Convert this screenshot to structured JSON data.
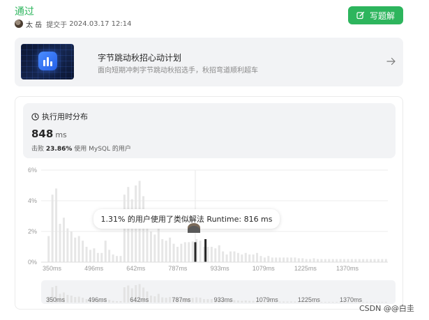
{
  "submission": {
    "status": "通过",
    "author": "太 岳",
    "submitted_label": "提交于",
    "submitted_at": "2024.03.17 12:14",
    "solve_button": "写题解"
  },
  "banner": {
    "title": "字节跳动秋招心动计划",
    "subtitle": "面向短期冲刺字节跳动秋招选手，秋招弯道顺利超车"
  },
  "runtime": {
    "header": "执行用时分布",
    "value": "848",
    "unit": "ms",
    "beat_prefix": "击败",
    "beat_percent": "23.86%",
    "beat_suffix": "使用 MySQL 的用户"
  },
  "tooltip": "1.31% 的用户使用了类似解法 Runtime: 816 ms",
  "watermark": "CSDN @@白圭",
  "colors": {
    "accent": "#2db55d",
    "bar": "#e6e6e6",
    "highlight": "#262626"
  },
  "chart_data": {
    "type": "bar",
    "ylabel": "",
    "ylim": [
      0,
      6
    ],
    "y_ticks": [
      "0%",
      "2%",
      "4%",
      "6%"
    ],
    "x_ticks": [
      "350ms",
      "496ms",
      "642ms",
      "787ms",
      "933ms",
      "1079ms",
      "1225ms",
      "1370ms"
    ],
    "x_range_ms": [
      350,
      1420
    ],
    "series": [
      {
        "values": [
          1.7,
          4.4,
          4.8,
          2.5,
          2.9,
          2.2,
          2.0,
          1.6,
          1.7,
          1.4,
          1.0,
          0.8,
          0.9,
          0.6,
          0.6,
          1.4,
          0.8,
          0.5,
          0.4,
          0.4,
          4.4,
          4.9,
          4.1,
          5.0,
          5.3,
          4.3,
          3.2,
          2.0,
          1.8,
          2.5,
          1.5,
          1.4,
          1.6,
          1.2,
          1.0,
          1.2,
          1.3,
          1.3,
          1.35,
          1.5,
          1.4,
          1.0,
          1.0,
          1.0,
          0.9,
          1.1,
          0.7,
          0.5,
          0.7,
          0.7,
          0.6,
          0.5,
          0.6,
          0.5,
          0.5,
          0.6,
          0.4,
          0.3,
          0.4,
          0.3,
          0.3,
          0.3,
          0.3,
          0.3,
          0.3,
          0.3,
          0.25,
          0.25,
          0.2,
          0.2,
          0.25,
          0.2,
          0.2,
          0.2,
          0.2,
          0.2,
          0.2,
          0.2,
          0.2,
          0.2,
          0.2,
          0.2,
          0.2,
          0.2,
          0.2,
          0.2,
          0.2,
          0.2,
          0.2,
          0.2
        ]
      }
    ],
    "highlight_ms": [
      816,
      848
    ],
    "highlight_values": [
      1.3,
      1.5
    ]
  }
}
